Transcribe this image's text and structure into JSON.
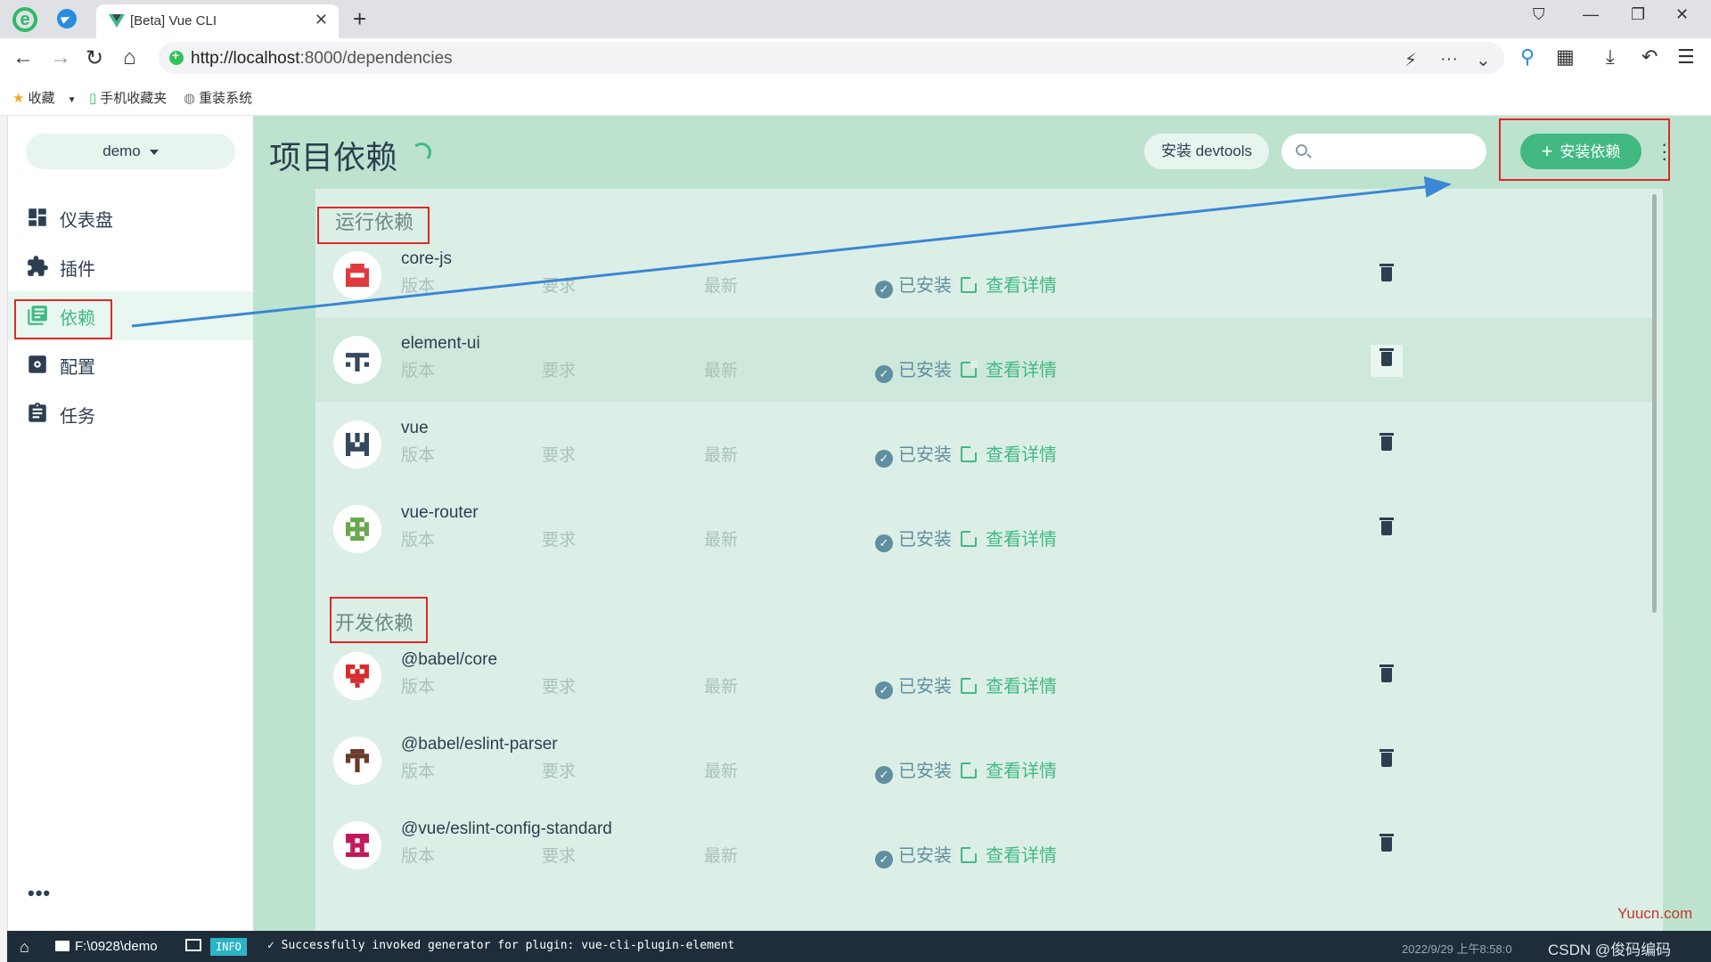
{
  "browser": {
    "tab_title": "[Beta] Vue CLI",
    "url_host": "http://localhost",
    "url_path": ":8000/dependencies",
    "bookmarks": [
      "收藏",
      "手机收藏夹",
      "重装系统"
    ]
  },
  "sidebar": {
    "project": "demo",
    "items": [
      {
        "label": "仪表盘",
        "icon": "dashboard-icon"
      },
      {
        "label": "插件",
        "icon": "puzzle-icon"
      },
      {
        "label": "依赖",
        "icon": "library-icon"
      },
      {
        "label": "配置",
        "icon": "settings-icon"
      },
      {
        "label": "任务",
        "icon": "clipboard-icon"
      }
    ],
    "active_index": 2
  },
  "header": {
    "title": "项目依赖",
    "devtools_label": "安装 devtools",
    "search_placeholder": "",
    "install_label": "安装依赖"
  },
  "labels": {
    "version": "版本",
    "required": "要求",
    "latest": "最新",
    "installed": "已安装",
    "details": "查看详情"
  },
  "sections": {
    "runtime": {
      "title": "运行依赖",
      "deps": [
        "core-js",
        "element-ui",
        "vue",
        "vue-router"
      ]
    },
    "dev": {
      "title": "开发依赖",
      "deps": [
        "@babel/core",
        "@babel/eslint-parser",
        "@vue/eslint-config-standard"
      ]
    }
  },
  "statusbar": {
    "folder": "F:\\0928\\demo",
    "log_level": "INFO",
    "message": "✓ Successfully invoked generator for plugin: vue-cli-plugin-element",
    "time": "2022/9/29 上午8:58:0"
  },
  "watermark": {
    "site": "Yuucn.com",
    "csdn": "CSDN @俊码编码"
  },
  "colors": {
    "accent": "#42b983",
    "content_bg": "#bde3cf",
    "annotation": "#e02727",
    "arrow": "#3a87d6"
  }
}
